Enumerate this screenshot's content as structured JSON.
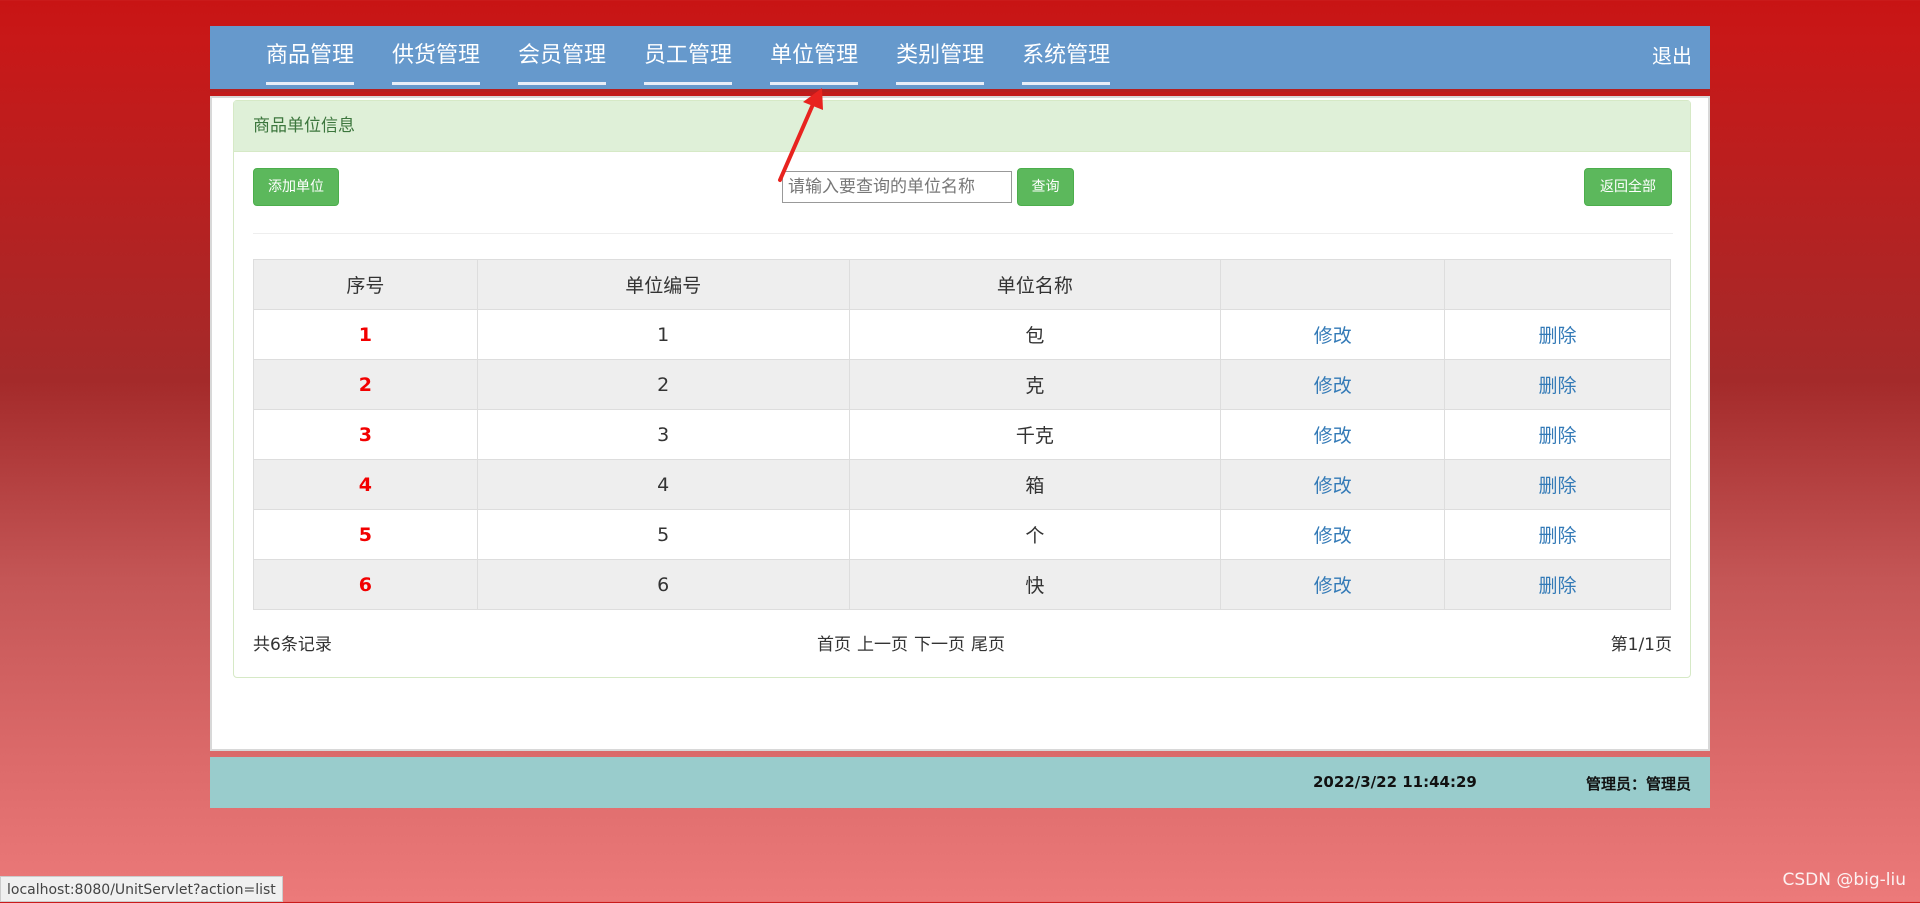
{
  "nav": {
    "items": [
      {
        "label": "商品管理"
      },
      {
        "label": "供货管理"
      },
      {
        "label": "会员管理"
      },
      {
        "label": "员工管理"
      },
      {
        "label": "单位管理"
      },
      {
        "label": "类别管理"
      },
      {
        "label": "系统管理"
      }
    ],
    "logout": "退出"
  },
  "panel": {
    "title": "商品单位信息",
    "add_button": "添加单位",
    "search_placeholder": "请输入要查询的单位名称",
    "search_button": "查询",
    "return_button": "返回全部"
  },
  "table": {
    "headers": [
      "序号",
      "单位编号",
      "单位名称",
      "",
      ""
    ],
    "rows": [
      {
        "index": "1",
        "code": "1",
        "name": "包",
        "edit": "修改",
        "delete": "删除"
      },
      {
        "index": "2",
        "code": "2",
        "name": "克",
        "edit": "修改",
        "delete": "删除"
      },
      {
        "index": "3",
        "code": "3",
        "name": "千克",
        "edit": "修改",
        "delete": "删除"
      },
      {
        "index": "4",
        "code": "4",
        "name": "箱",
        "edit": "修改",
        "delete": "删除"
      },
      {
        "index": "5",
        "code": "5",
        "name": "个",
        "edit": "修改",
        "delete": "删除"
      },
      {
        "index": "6",
        "code": "6",
        "name": "快",
        "edit": "修改",
        "delete": "删除"
      }
    ]
  },
  "pagination": {
    "total": "共6条记录",
    "first": "首页",
    "prev": "上一页",
    "next": "下一页",
    "last": "尾页",
    "page_info": "第1/1页"
  },
  "footer": {
    "datetime": "2022/3/22 11:44:29",
    "user": "管理员：管理员"
  },
  "status_bar": {
    "url": "localhost:8080/UnitServlet?action=list"
  },
  "watermark": "CSDN @big-liu",
  "colors": {
    "nav_bg": "#6699cc",
    "green_button": "#5cb85c",
    "index_red": "#f20000",
    "link_blue": "#337ab7",
    "footer_bg": "#99cccc",
    "arrow_red": "#e8231f"
  }
}
